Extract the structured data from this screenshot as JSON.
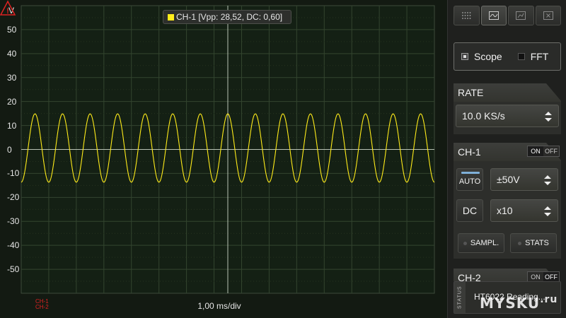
{
  "scope": {
    "unit": "V",
    "y_ticks": [
      "50",
      "40",
      "30",
      "20",
      "10",
      "0",
      "-10",
      "-20",
      "-30",
      "-40",
      "-50"
    ],
    "legend": "CH-1 [Vpp: 28,52, DC: 0,60]",
    "timebase": "1,00 ms/div",
    "trigger_ch1": "CH-1",
    "trigger_ch2": "CH-2",
    "trace_color": "#ffec1a",
    "signal": {
      "amplitude_v": 14.26,
      "offset_v": 0.6,
      "cycles": 15
    }
  },
  "toolbar": {
    "items": [
      {
        "icon": "grid-dots-icon"
      },
      {
        "icon": "waveform-icon",
        "active": true
      },
      {
        "icon": "chart-icon"
      },
      {
        "icon": "close-box-icon"
      }
    ]
  },
  "mode": {
    "scope_label": "Scope",
    "fft_label": "FFT"
  },
  "rate": {
    "title": "RATE",
    "value": "10.0 KS/s"
  },
  "ch1": {
    "title": "CH-1",
    "on_label": "ON",
    "off_label": "OFF",
    "auto_label": "AUTO",
    "range": "±50V",
    "coupling": "DC",
    "probe": "x10",
    "sampl_label": "SAMPL.",
    "stats_label": "STATS"
  },
  "ch2": {
    "title": "CH-2",
    "on_label": "ON",
    "off_label": "OFF"
  },
  "status": {
    "tag": "STATUS",
    "text": "HT6022 Reading..."
  },
  "watermark": {
    "text": "MYSKU",
    "suffix": ".ru"
  }
}
